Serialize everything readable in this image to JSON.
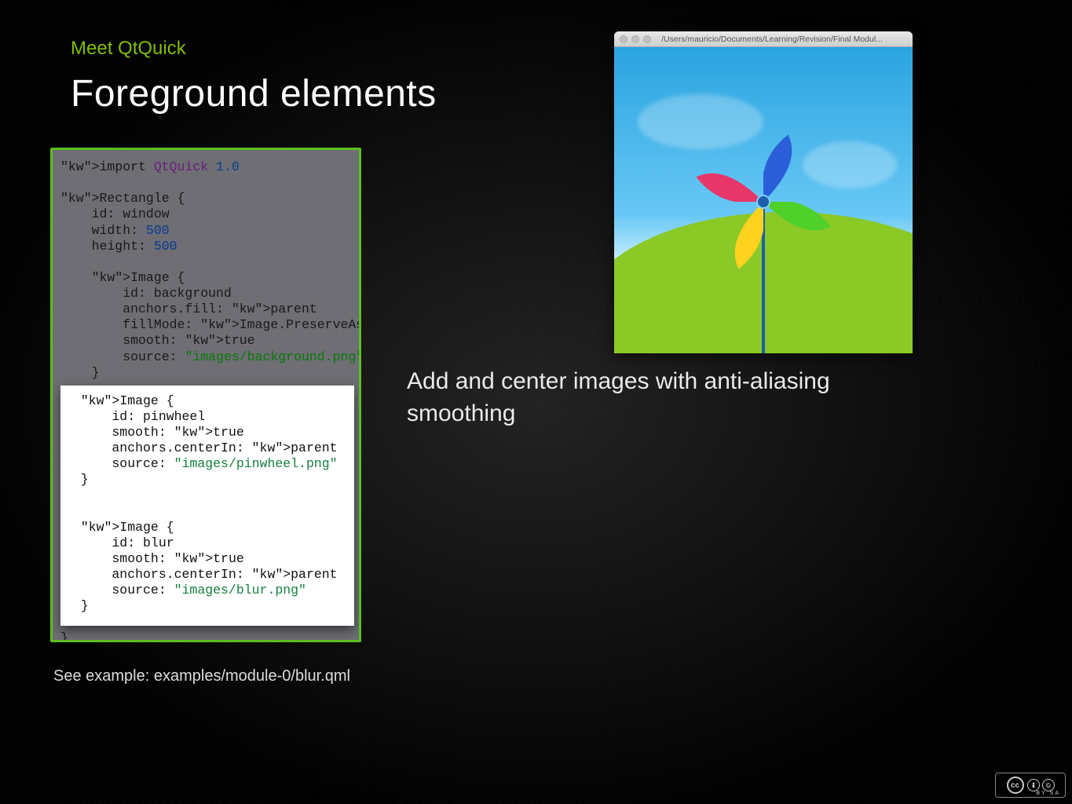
{
  "section_label": "Meet QtQuick",
  "title": "Foreground elements",
  "caption": "Add and center images with anti-aliasing smoothing",
  "example_ref": "See example: examples/module-0/blur.qml",
  "app_window": {
    "title_path": "/Users/mauricio/Documents/Learning/Revision/Final Modul..."
  },
  "cc": {
    "label": "cc",
    "by": "BY",
    "sa": "SA"
  },
  "code": {
    "dim": "import QtQuick 1.0\n\nRectangle {\n    id: window\n    width: 500\n    height: 500\n\n    Image {\n        id: background\n        anchors.fill: parent\n        fillMode: Image.PreserveAspectCrop\n        smooth: true\n        source: \"images/background.png\"\n    }",
    "hi": "  Image {\n      id: pinwheel\n      smooth: true\n      anchors.centerIn: parent\n      source: \"images/pinwheel.png\"\n  }\n\n\n  Image {\n      id: blur\n      smooth: true\n      anchors.centerIn: parent\n      source: \"images/blur.png\"\n  }",
    "dim_tail": "}"
  }
}
